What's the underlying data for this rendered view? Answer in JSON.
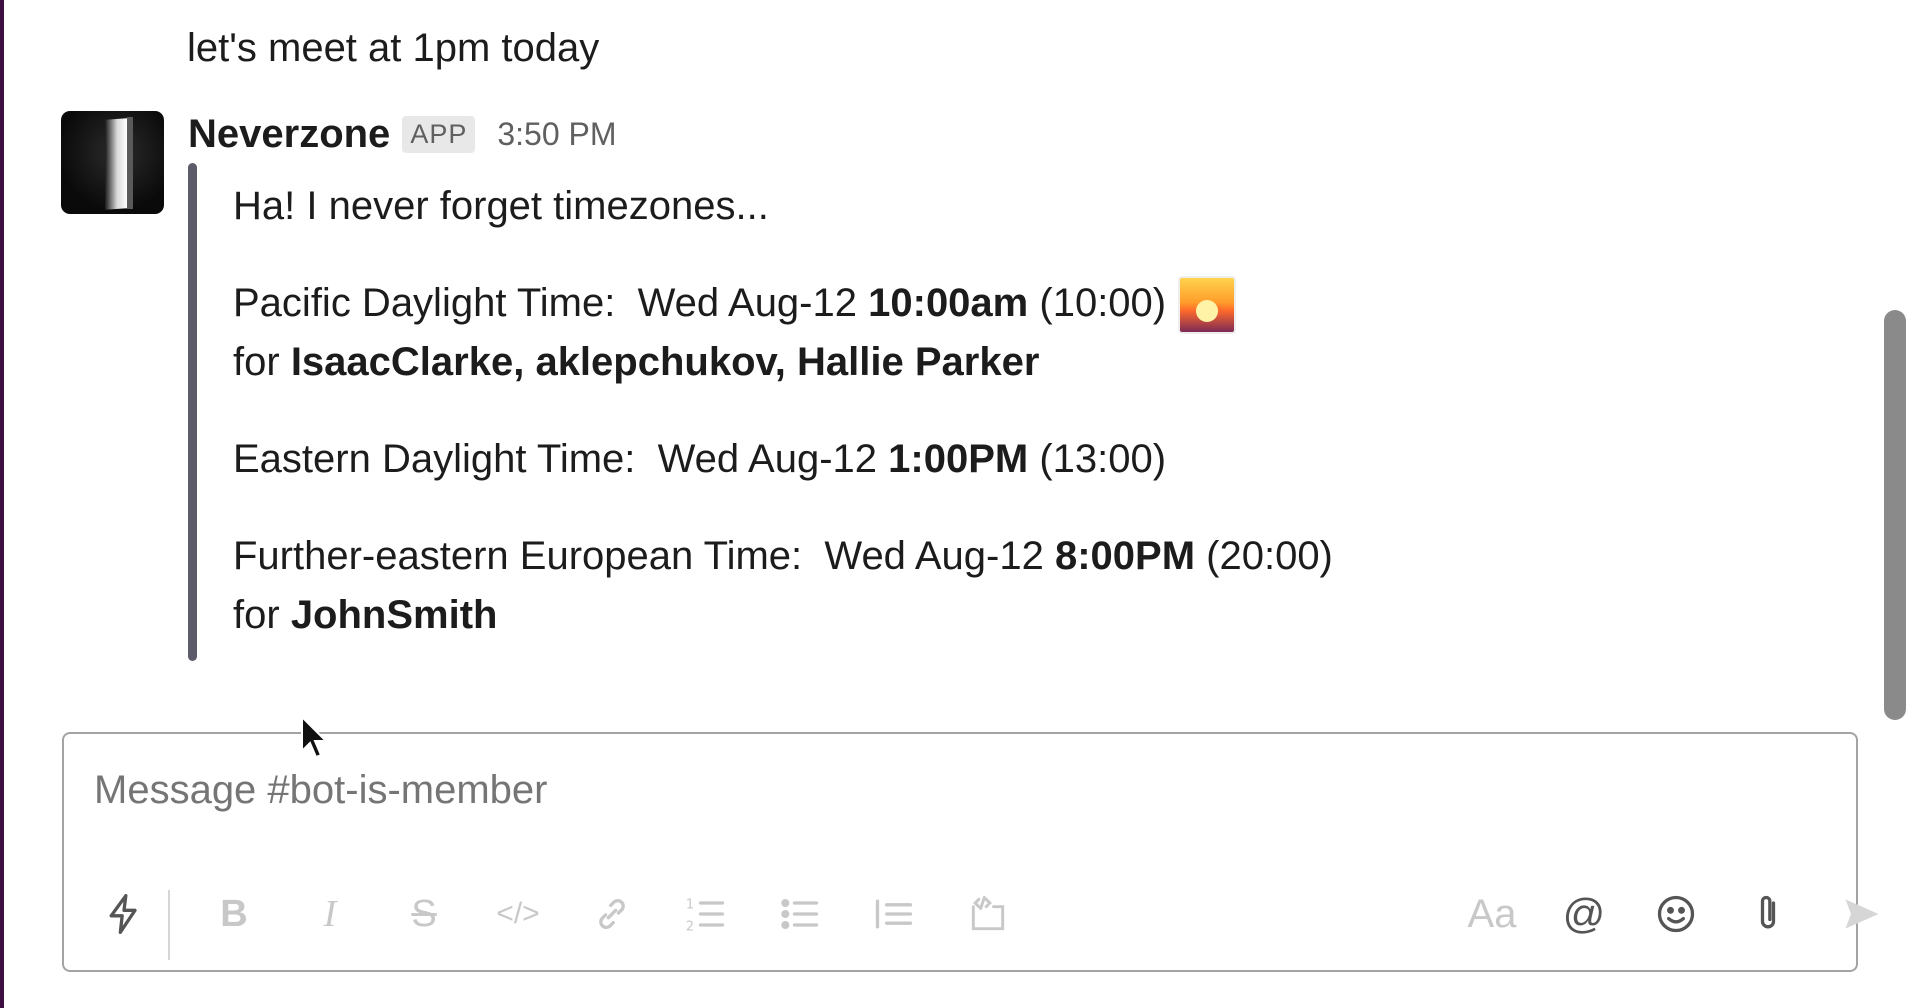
{
  "channel": {
    "previous_message": "let's meet at 1pm today"
  },
  "message": {
    "sender": "Neverzone",
    "badge": "APP",
    "timestamp": "3:50 PM",
    "avatar_icon": "door-avatar",
    "intro": "Ha! I never forget timezones...",
    "zones": [
      {
        "zone": "Pacific Daylight Time:",
        "date": "Wed Aug-12",
        "time_bold": "10:00am",
        "time_24h": "(10:00)",
        "emoji": "sunrise-emoji",
        "for_prefix": "for",
        "users": "IsaacClarke, aklepchukov, Hallie Parker"
      },
      {
        "zone": "Eastern Daylight Time:",
        "date": "Wed Aug-12",
        "time_bold": "1:00PM",
        "time_24h": "(13:00)"
      },
      {
        "zone": "Further-eastern European Time:",
        "date": "Wed Aug-12",
        "time_bold": "8:00PM",
        "time_24h": "(20:00)",
        "for_prefix": "for",
        "users": "JohnSmith"
      }
    ]
  },
  "composer": {
    "placeholder": "Message #bot-is-member",
    "toolbar": {
      "shortcuts_icon": "lightning-icon",
      "bold_label": "B",
      "italic_label": "I",
      "strike_label": "S",
      "code_label": "</>",
      "link_icon": "link-icon",
      "ordered_list_icon": "ordered-list-icon",
      "bullet_list_icon": "bullet-list-icon",
      "blockquote_icon": "blockquote-icon",
      "code_block_icon": "code-block-icon",
      "format_label": "Aa",
      "mention_label": "@",
      "emoji_icon": "emoji-icon",
      "attach_icon": "paperclip-icon",
      "send_icon": "send-icon"
    }
  },
  "colors": {
    "sidebar_edge": "#3f0e40",
    "attachment_bar": "#5b5b6a",
    "text": "#1d1c1d",
    "muted": "#616061",
    "toolbar_disabled": "#c8c8c8"
  }
}
